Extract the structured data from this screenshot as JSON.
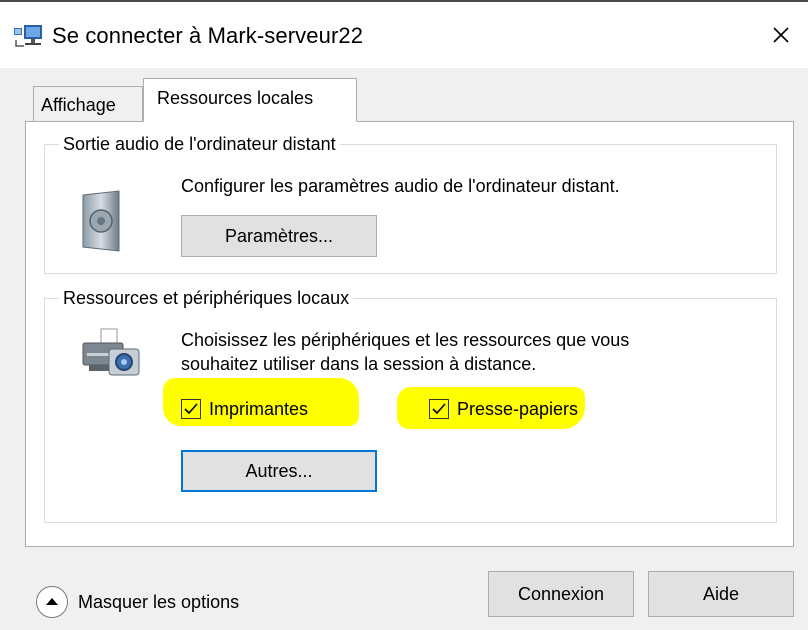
{
  "window": {
    "title": "Se connecter à Mark-serveur22",
    "icon": "remote-desktop-icon",
    "close_glyph": "✕"
  },
  "tabs": [
    {
      "label": "Affichage",
      "active": false
    },
    {
      "label": "Ressources locales",
      "active": true
    }
  ],
  "audio_group": {
    "legend": "Sortie audio de l'ordinateur distant",
    "description": "Configurer les paramètres audio de l'ordinateur distant.",
    "button_label": "Paramètres...",
    "icon": "speaker-icon"
  },
  "resources_group": {
    "legend": "Ressources et périphériques locaux",
    "description_line1": "Choisissez les périphériques et les ressources que vous",
    "description_line2": "souhaitez utiliser dans la session à distance.",
    "icon": "printer-camera-icon",
    "checkboxes": [
      {
        "label": "Imprimantes",
        "checked": true
      },
      {
        "label": "Presse-papiers",
        "checked": true
      }
    ],
    "button_label": "Autres..."
  },
  "footer": {
    "toggle_label": "Masquer les options",
    "connect_label": "Connexion",
    "help_label": "Aide"
  },
  "colors": {
    "highlight": "#ffff00",
    "focus_border": "#0078d7",
    "window_bg": "#f0f0f0"
  }
}
